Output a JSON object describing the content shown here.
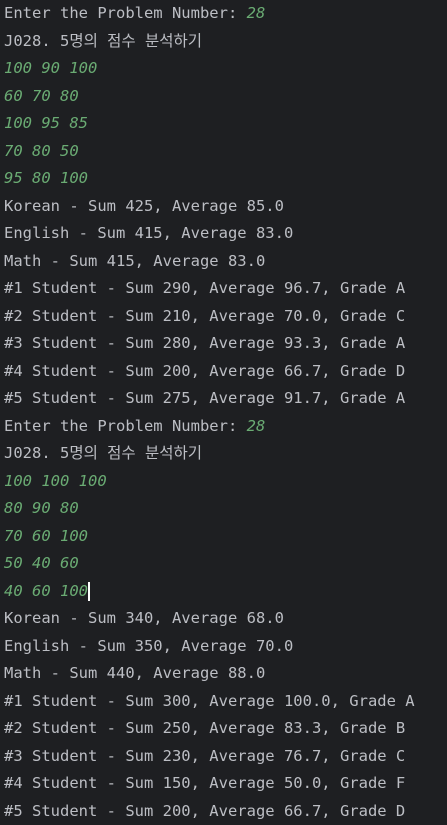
{
  "run1": {
    "prompt": {
      "label": "Enter the Problem Number: ",
      "value": "28"
    },
    "title": "J028. 5명의 점수 분석하기",
    "inputs": [
      "100 90 100",
      "60 70 80",
      "100 95 85",
      "70 80 50",
      "95 80 100"
    ],
    "subjects": [
      "Korean - Sum 425, Average 85.0",
      "English - Sum 415, Average 83.0",
      "Math - Sum 415, Average 83.0"
    ],
    "students": [
      "#1 Student - Sum 290, Average 96.7, Grade A",
      "#2 Student - Sum 210, Average 70.0, Grade C",
      "#3 Student - Sum 280, Average 93.3, Grade A",
      "#4 Student - Sum 200, Average 66.7, Grade D",
      "#5 Student - Sum 275, Average 91.7, Grade A"
    ]
  },
  "run2": {
    "prompt": {
      "label": "Enter the Problem Number: ",
      "value": "28"
    },
    "title": "J028. 5명의 점수 분석하기",
    "inputs": [
      "100 100 100",
      "80 90 80",
      "70 60 100",
      "50 40 60",
      "40 60 100"
    ],
    "subjects": [
      "Korean - Sum 340, Average 68.0",
      "English - Sum 350, Average 70.0",
      "Math - Sum 440, Average 88.0"
    ],
    "students": [
      "#1 Student - Sum 300, Average 100.0, Grade A",
      "#2 Student - Sum 250, Average 83.3, Grade B",
      "#3 Student - Sum 230, Average 76.7, Grade C",
      "#4 Student - Sum 150, Average 50.0, Grade F",
      "#5 Student - Sum 200, Average 66.7, Grade D"
    ]
  },
  "colors": {
    "background": "#1e1f22",
    "output_text": "#bcbec4",
    "user_input": "#6aab73",
    "cursor": "#ffffff"
  }
}
